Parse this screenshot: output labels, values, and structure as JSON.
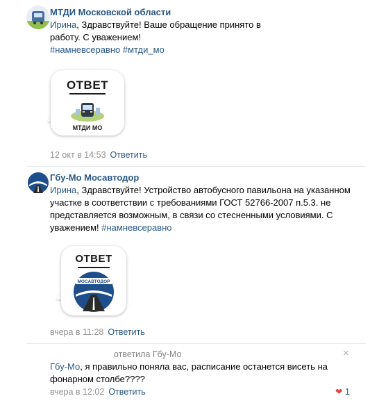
{
  "comments": [
    {
      "author": "МТДИ Московской области",
      "addressee": "Ирина",
      "text": ", Здравствуйте! Ваше обращение принято в работу. С уважением!",
      "hashtags": "#намневсеравно #мтди_мо",
      "card": {
        "title": "ОТВЕТ",
        "sub": "МТДИ МО"
      },
      "date": "12 окт в 14:53",
      "reply_label": "Ответить"
    },
    {
      "author": "Гбу-Мо Мосавтодор",
      "addressee": "Ирина",
      "text": ", Здравствуйте! Устройство автобусного павильона на указанном участке в соответствии с требованиями ГОСТ 52766-2007 п.5.3. не представляется возможным, в связи со стесненными условиями. С уважением! ",
      "hashtags": "#намневсеравно",
      "card": {
        "title": "ОТВЕТ",
        "sub": "МОСАВТОДОР"
      },
      "date": "вчера в 11:28",
      "reply_label": "Ответить"
    },
    {
      "replied_to": "ответила Гбу-Мо",
      "addressee": "Гбу-Мо",
      "text": ", я правильно поняла вас, расписание останется висеть на фонарном столбе????",
      "date": "вчера в 12:02",
      "reply_label": "Ответить",
      "close_icon": "×",
      "likes": "1"
    }
  ]
}
